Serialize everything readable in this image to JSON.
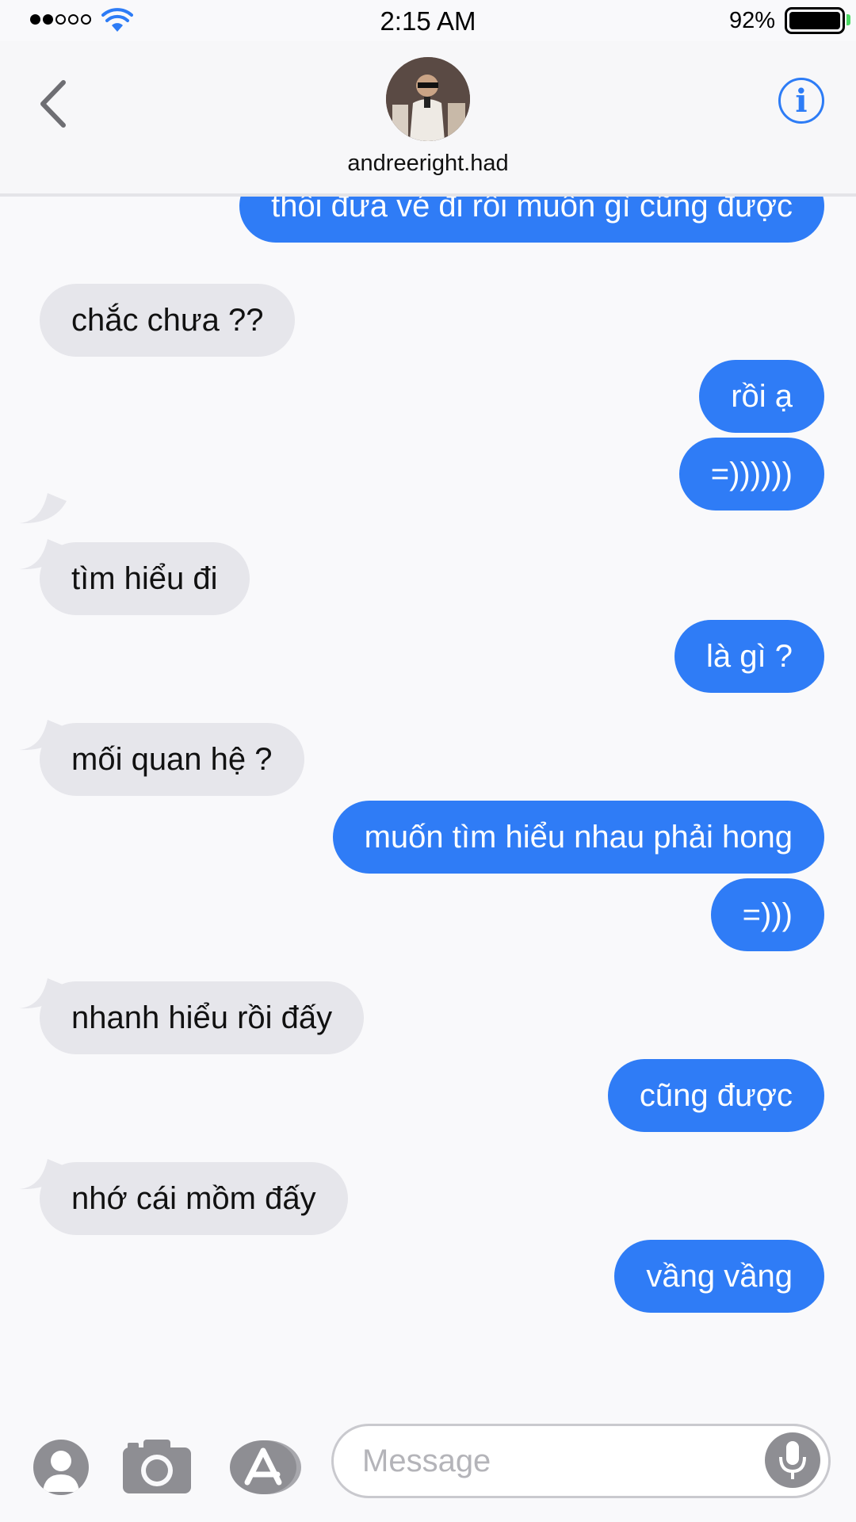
{
  "status_bar": {
    "time": "2:15 AM",
    "battery": "92%",
    "signal_bars_filled": 2,
    "signal_bars_total": 5
  },
  "header": {
    "contact_name": "andreeright.had",
    "info_label": "i"
  },
  "messages": [
    {
      "direction": "sent",
      "text": "thôi đưa vé đi rồi muốn gì cũng được"
    },
    {
      "direction": "received",
      "text": "chắc chưa ??"
    },
    {
      "direction": "sent",
      "text": "rồi ạ"
    },
    {
      "direction": "sent",
      "text": "=))))))"
    },
    {
      "direction": "received",
      "text": "tìm hiểu đi"
    },
    {
      "direction": "sent",
      "text": "là gì ?"
    },
    {
      "direction": "received",
      "text": "mối quan hệ ?"
    },
    {
      "direction": "sent",
      "text": "muốn tìm hiểu nhau phải hong"
    },
    {
      "direction": "sent",
      "text": "=)))"
    },
    {
      "direction": "received",
      "text": "nhanh hiểu rồi đấy"
    },
    {
      "direction": "sent",
      "text": "cũng được"
    },
    {
      "direction": "received",
      "text": "nhớ cái mồm đấy"
    },
    {
      "direction": "sent",
      "text": "vầng vầng"
    }
  ],
  "input": {
    "placeholder": "Message",
    "value": ""
  },
  "colors": {
    "sent_bubble": "#2f7cf6",
    "received_bubble": "#e6e6eb",
    "accent": "#2d7cf6"
  }
}
